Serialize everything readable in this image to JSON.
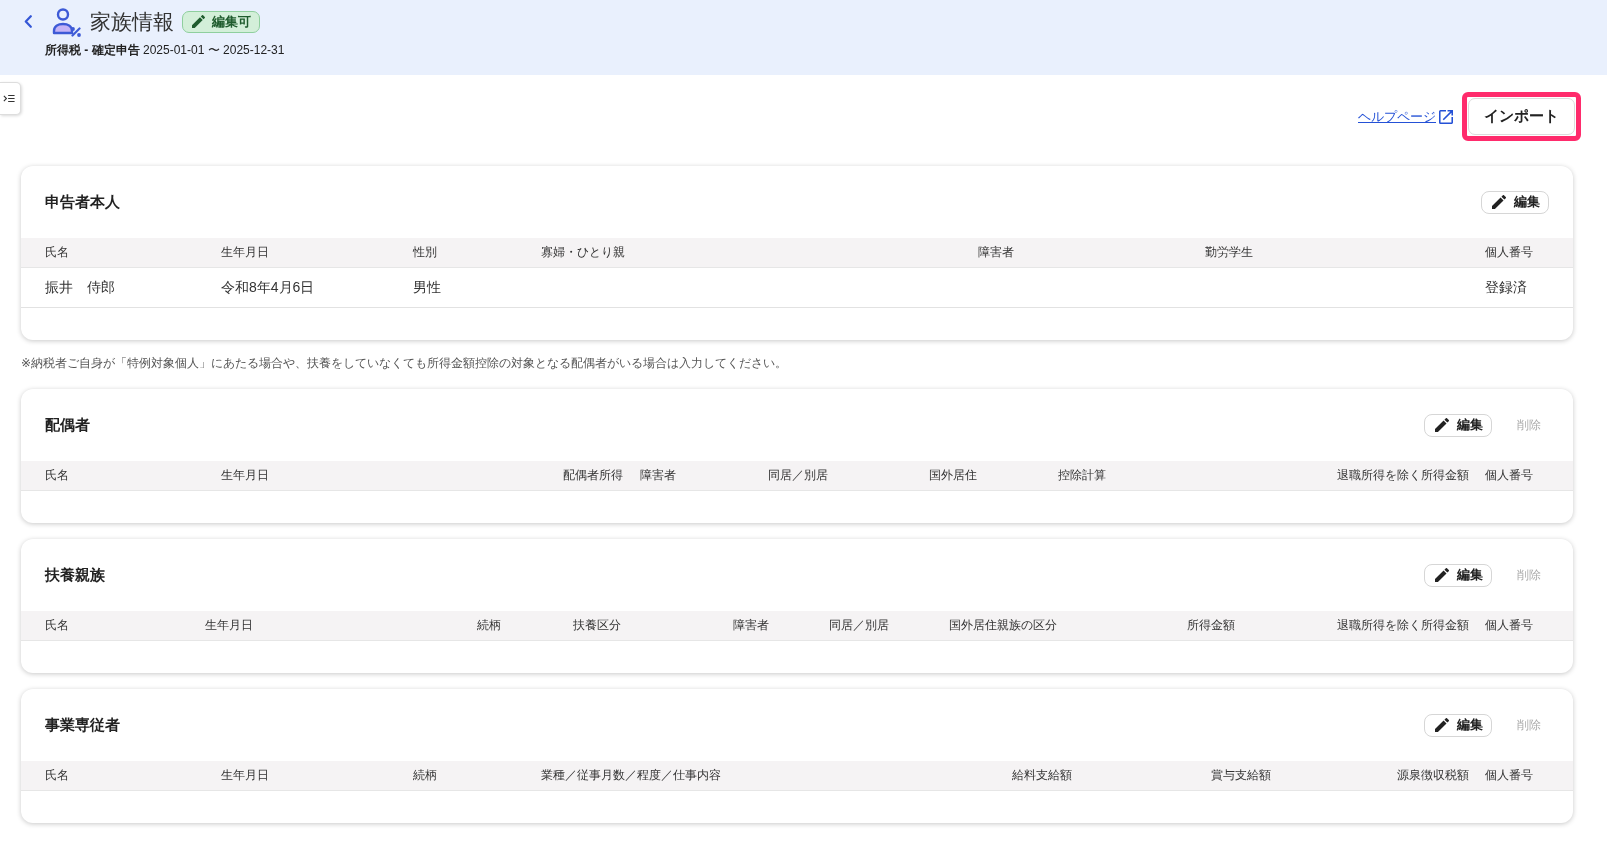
{
  "header": {
    "title": "家族情報",
    "badge": {
      "label": "編集可"
    },
    "subtitle": "**所得税 - 確定申告** 2025-01-01 〜 2025-12-31"
  },
  "toolbar": {
    "help_link": "ヘルプページ",
    "import_button": {
      "label": "インポート",
      "highlighted": true
    }
  },
  "sections": [
    {
      "title": "申告者本人",
      "actions": [
        {
          "kind": "edit",
          "label": "編集",
          "disabled": false
        }
      ],
      "columns": [
        "氏名",
        "生年月日",
        "性別",
        "寡婦・ひとり親",
        "障害者",
        "勤労学生",
        "個人番号"
      ],
      "rows": [
        [
          "振井　侍郎",
          "令和8年4月6日",
          "男性",
          null,
          null,
          null,
          "登録済"
        ]
      ],
      "note": "※納税者ご自身が「特例対象個人」にあたる場合や、扶養をしていなくても所得金額控除の対象となる配偶者がいる場合は入力してください。"
    },
    {
      "title": "配偶者",
      "actions": [
        {
          "kind": "edit",
          "label": "編集",
          "disabled": false
        },
        {
          "kind": "delete",
          "label": "削除",
          "disabled": true
        }
      ],
      "columns": [
        "氏名",
        "生年月日",
        "配偶者所得",
        "障害者",
        "同居／別居",
        "国外居住",
        "控除計算",
        "退職所得を除く所得金額",
        "個人番号"
      ]
    },
    {
      "title": "扶養親族",
      "actions": [
        {
          "kind": "edit",
          "label": "編集",
          "disabled": false
        },
        {
          "kind": "delete",
          "label": "削除",
          "disabled": true
        }
      ],
      "columns": [
        "氏名",
        "生年月日",
        "続柄",
        "扶養区分",
        "障害者",
        "同居／別居",
        "国外居住親族の区分",
        "所得金額",
        "退職所得を除く所得金額",
        "個人番号"
      ]
    },
    {
      "title": "事業専従者",
      "actions": [
        {
          "kind": "edit",
          "label": "編集",
          "disabled": false
        },
        {
          "kind": "delete",
          "label": "削除",
          "disabled": true
        }
      ],
      "columns": [
        "氏名",
        "生年月日",
        "続柄",
        "業種／従事月数／程度／仕事内容",
        "給料支給額",
        "賞与支給額",
        "源泉徴収税額",
        "個人番号"
      ]
    }
  ]
}
